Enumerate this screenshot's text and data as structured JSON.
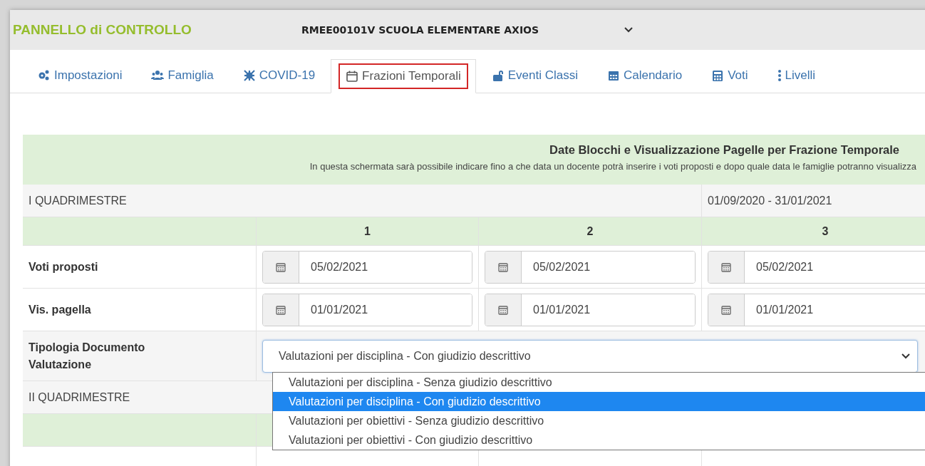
{
  "header": {
    "title": "PANNELLO di CONTROLLO",
    "school_select": {
      "value": "RMEE00101V SCUOLA ELEMENTARE AXIOS"
    }
  },
  "tabs": [
    {
      "label": "Impostazioni",
      "selected": false
    },
    {
      "label": "Famiglia",
      "selected": false
    },
    {
      "label": "COVID-19",
      "selected": false
    },
    {
      "label": "Frazioni Temporali",
      "selected": true
    },
    {
      "label": "Eventi Classi",
      "selected": false
    },
    {
      "label": "Calendario",
      "selected": false
    },
    {
      "label": "Voti",
      "selected": false
    },
    {
      "label": "Livelli",
      "selected": false
    }
  ],
  "panel": {
    "title": "Date Blocchi e Visualizzazione Pagelle per Frazione Temporale",
    "subtitle": "In questa schermata sarà possibile indicare fino a che data un docente potrà inserire i voti proposti e dopo quale data le famiglie potranno visualizza",
    "sections": [
      {
        "name": "I QUADRIMESTRE",
        "dates": "01/09/2020 - 31/01/2021",
        "columns": [
          "1",
          "2",
          "3"
        ],
        "rows": [
          {
            "label": "Voti proposti",
            "values": [
              "05/02/2021",
              "05/02/2021",
              "05/02/2021"
            ]
          },
          {
            "label": "Vis. pagella",
            "values": [
              "01/01/2021",
              "01/01/2021",
              "01/01/2021"
            ]
          }
        ],
        "document_type": {
          "label": "Tipologia Documento Valutazione",
          "value": "Valutazioni per disciplina - Con giudizio descrittivo",
          "expanded": true,
          "options": [
            {
              "label": "Valutazioni per disciplina - Senza giudizio descrittivo",
              "selected": false
            },
            {
              "label": "Valutazioni per disciplina - Con giudizio descrittivo",
              "selected": true
            },
            {
              "label": "Valutazioni per obiettivi - Senza giudizio descrittivo",
              "selected": false
            },
            {
              "label": "Valutazioni per obiettivi - Con giudizio descrittivo",
              "selected": false
            }
          ]
        }
      },
      {
        "name": "II QUADRIMESTRE"
      }
    ]
  }
}
